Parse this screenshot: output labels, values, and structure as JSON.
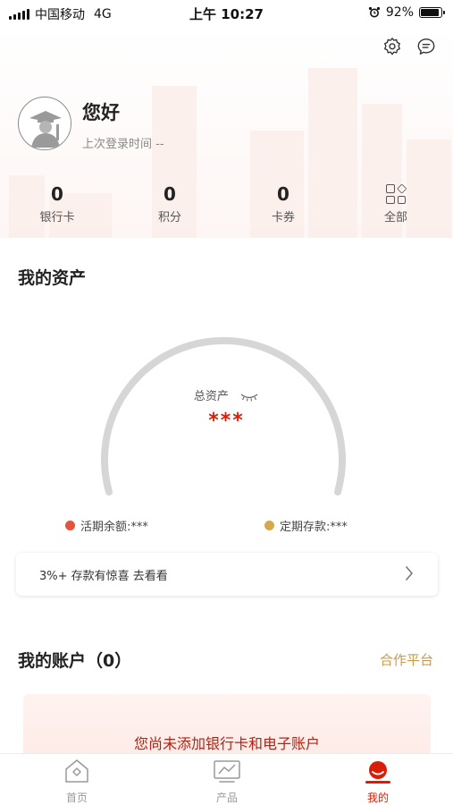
{
  "status_bar": {
    "carrier": "中国移动",
    "network": "4G",
    "time": "上午 10:27",
    "battery_text": "92%",
    "battery_level": 0.92
  },
  "header": {
    "greeting": "您好",
    "last_login": "上次登录时间 --",
    "icons": [
      "settings-icon",
      "message-icon"
    ]
  },
  "stats": [
    {
      "value": "0",
      "label": "银行卡"
    },
    {
      "value": "0",
      "label": "积分"
    },
    {
      "value": "0",
      "label": "卡券"
    }
  ],
  "all_label": "全部",
  "assets": {
    "title": "我的资产",
    "total_label": "总资产",
    "total_value": "***",
    "current_balance": "活期余额:***",
    "fixed_deposit": "定期存款:***",
    "current_color": "#e2553c",
    "fixed_color": "#d9a84e"
  },
  "promo": {
    "text": "3%+ 存款有惊喜 去看看"
  },
  "accounts": {
    "title": "我的账户（0）",
    "partner_link": "合作平台",
    "empty_text": "您尚未添加银行卡和电子账户"
  },
  "tabs": [
    {
      "label": "首页",
      "icon": "home-icon",
      "active": false
    },
    {
      "label": "产品",
      "icon": "chart-icon",
      "active": false
    },
    {
      "label": "我的",
      "icon": "profile-icon",
      "active": true
    }
  ],
  "colors": {
    "accent": "#d81e06",
    "gold": "#c99a4a"
  }
}
